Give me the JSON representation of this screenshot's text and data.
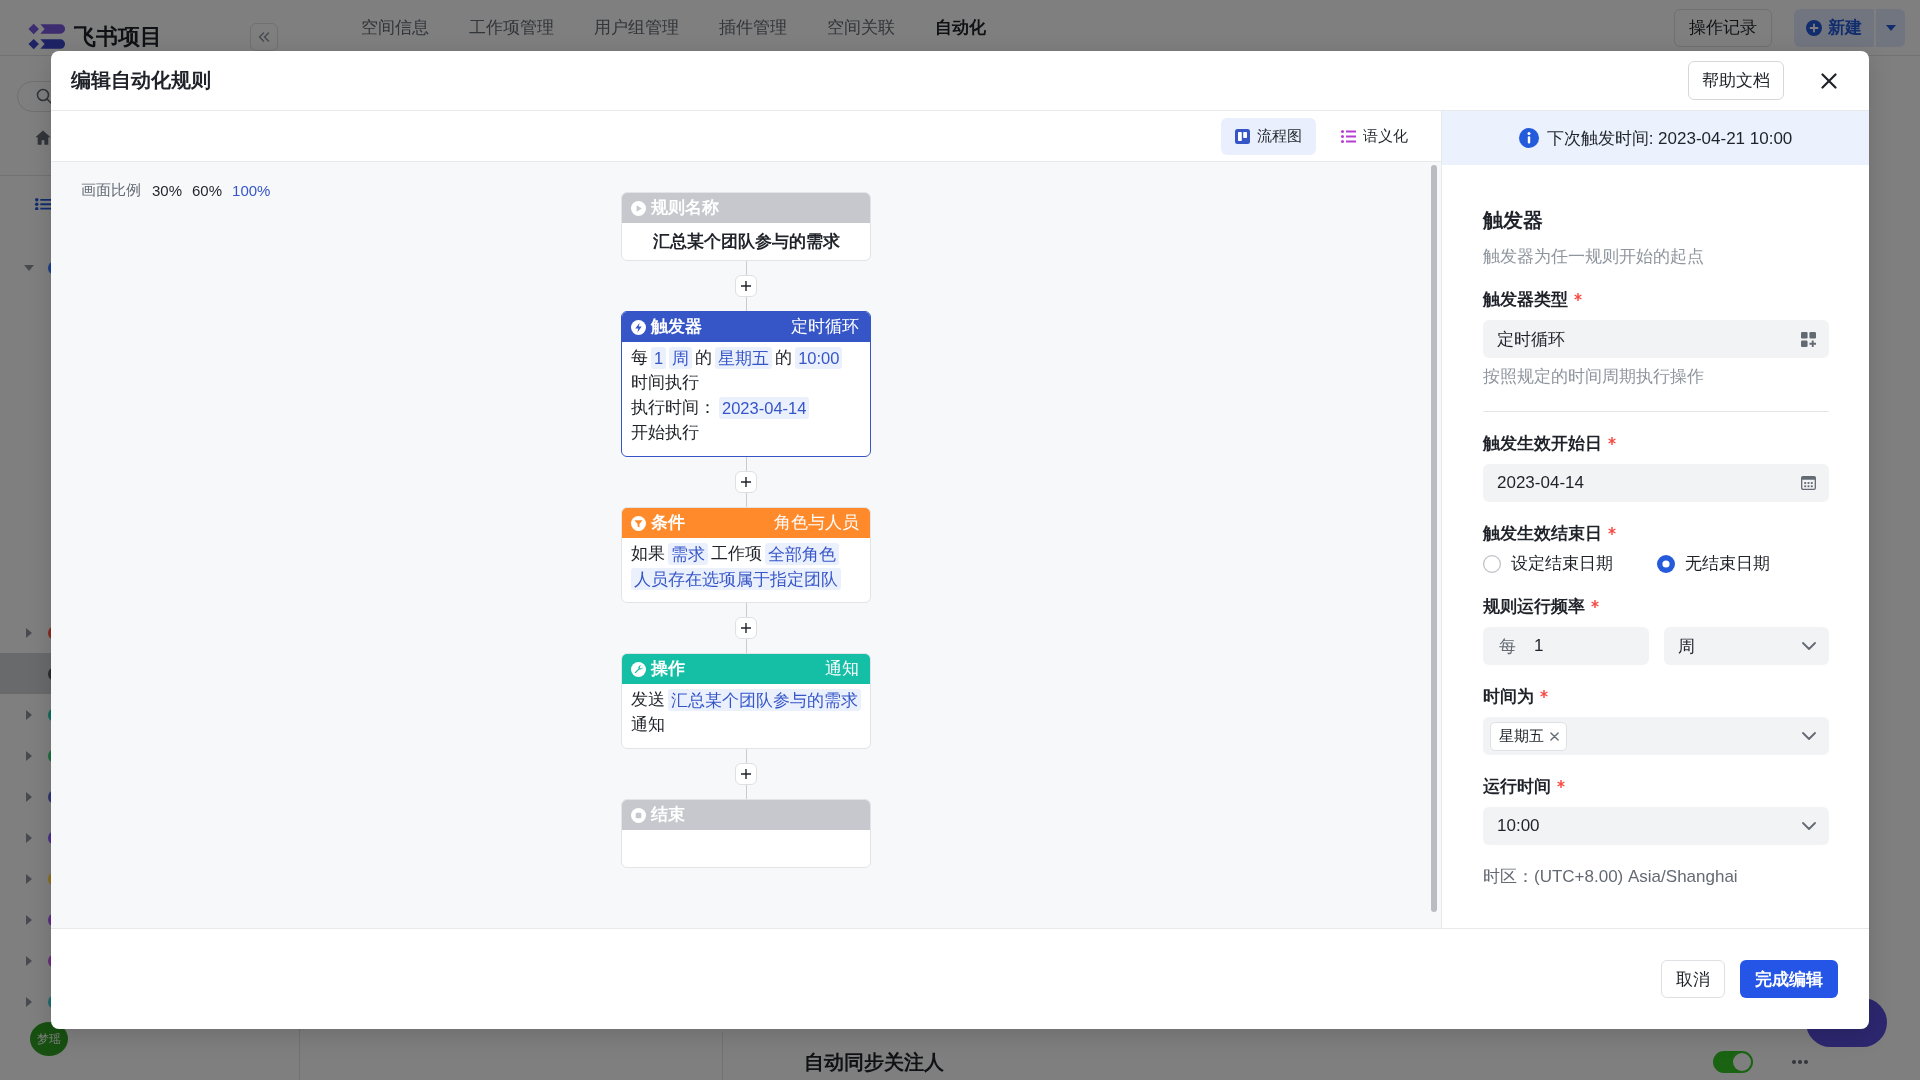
{
  "app": {
    "brand": "飞书项目",
    "nav": [
      {
        "label": "空间信息",
        "selected": false
      },
      {
        "label": "工作项管理",
        "selected": false
      },
      {
        "label": "用户组管理",
        "selected": false
      },
      {
        "label": "插件管理",
        "selected": false
      },
      {
        "label": "空间关联",
        "selected": false
      },
      {
        "label": "自动化",
        "selected": true
      }
    ],
    "history_button": "操作记录",
    "new_button": "新建",
    "sidebar": {
      "tree": [
        {
          "kind": "branch",
          "expanded": true,
          "selected": false,
          "color": "#1d3d8c"
        },
        {
          "kind": "branch",
          "expanded": false,
          "selected": false,
          "color": "#8a2a1e"
        },
        {
          "kind": "leaf",
          "selected": true,
          "color": "#2b2b2b"
        },
        {
          "kind": "branch",
          "expanded": false,
          "selected": false,
          "color": "#0d6b5e"
        },
        {
          "kind": "branch",
          "expanded": false,
          "selected": false,
          "color": "#1d6b3f"
        },
        {
          "kind": "branch",
          "expanded": false,
          "selected": false,
          "color": "#2e3470"
        },
        {
          "kind": "branch",
          "expanded": false,
          "selected": false,
          "color": "#4b2d8a"
        },
        {
          "kind": "branch",
          "expanded": false,
          "selected": false,
          "color": "#8c6d1c"
        },
        {
          "kind": "branch",
          "expanded": false,
          "selected": false,
          "color": "#5a2c80"
        },
        {
          "kind": "branch",
          "expanded": false,
          "selected": false,
          "color": "#6a2d78"
        },
        {
          "kind": "branch",
          "expanded": false,
          "selected": false,
          "color": "#1c6b6e"
        }
      ],
      "avatar": "梦瑶"
    },
    "auto_sync": {
      "label": "自动同步关注人",
      "on": true
    }
  },
  "modal": {
    "title": "编辑自动化规则",
    "help_button": "帮助文档",
    "view_tabs": [
      {
        "kind": "flowchart",
        "label": "流程图",
        "selected": true
      },
      {
        "kind": "semantic",
        "label": "语义化",
        "selected": false
      }
    ],
    "zoom": {
      "label": "画面比例",
      "options": [
        {
          "label": "30%",
          "selected": false
        },
        {
          "label": "60%",
          "selected": false
        },
        {
          "label": "100%",
          "selected": true
        }
      ]
    },
    "flow": {
      "nodes": [
        {
          "kind": "name",
          "color": "#c6c8cd",
          "title": "规则名称",
          "selected": false,
          "body": [
            [
              {
                "kind": "title",
                "text": "汇总某个团队参与的需求"
              }
            ]
          ]
        },
        {
          "kind": "trigger",
          "color": "#3656c8",
          "title": "触发器",
          "tag": "定时循环",
          "selected": true,
          "body": [
            [
              {
                "kind": "text",
                "text": "每"
              },
              {
                "kind": "chip",
                "text": "1"
              },
              {
                "kind": "chip",
                "text": "周"
              },
              {
                "kind": "text",
                "text": "的"
              },
              {
                "kind": "chip",
                "text": "星期五"
              },
              {
                "kind": "text",
                "text": "的"
              },
              {
                "kind": "chip",
                "text": "10:00"
              },
              {
                "kind": "text",
                "text": "时间执行"
              }
            ],
            [
              {
                "kind": "text",
                "text": "执行时间："
              },
              {
                "kind": "chip",
                "text": "2023-04-14"
              },
              {
                "kind": "text",
                "text": "开始执行"
              }
            ]
          ]
        },
        {
          "kind": "condition",
          "color": "#ff8a2b",
          "title": "条件",
          "tag": "角色与人员",
          "selected": false,
          "body": [
            [
              {
                "kind": "text",
                "text": "如果"
              },
              {
                "kind": "chip",
                "text": "需求"
              },
              {
                "kind": "text",
                "text": "工作项"
              },
              {
                "kind": "chip",
                "text": "全部角色"
              },
              {
                "kind": "chip",
                "text": "人员存在选项属于指定团队"
              }
            ]
          ]
        },
        {
          "kind": "action",
          "color": "#14bfa6",
          "title": "操作",
          "tag": "通知",
          "selected": false,
          "body": [
            [
              {
                "kind": "text",
                "text": "发送"
              },
              {
                "kind": "chip",
                "text": "汇总某个团队参与的需求"
              },
              {
                "kind": "text",
                "text": "通知"
              }
            ]
          ]
        },
        {
          "kind": "end",
          "color": "#c6c8cd",
          "title": "结束",
          "selected": false
        }
      ]
    },
    "panel": {
      "next_run": "下次触发时间: 2023-04-21 10:00",
      "title": "触发器",
      "description": "触发器为任一规则开始的起点",
      "fields": [
        {
          "kind": "picker",
          "label": "触发器类型",
          "required": true,
          "value": "定时循环",
          "help": "按照规定的时间周期执行操作"
        },
        {
          "kind": "date",
          "label": "触发生效开始日",
          "required": true,
          "value": "2023-04-14"
        },
        {
          "kind": "radio",
          "label": "触发生效结束日",
          "required": true,
          "options": [
            {
              "label": "设定结束日期",
              "selected": false
            },
            {
              "label": "无结束日期",
              "selected": true
            }
          ]
        },
        {
          "kind": "frequency",
          "label": "规则运行频率",
          "required": true,
          "prefix": "每",
          "value": "1",
          "unit": "周"
        },
        {
          "kind": "tags",
          "label": "时间为",
          "required": true,
          "tags": [
            "星期五"
          ]
        },
        {
          "kind": "select",
          "label": "运行时间",
          "required": true,
          "value": "10:00"
        }
      ],
      "timezone": "时区：(UTC+8.00) Asia/Shanghai"
    },
    "footer": {
      "buttons": [
        {
          "kind": "secondary",
          "label": "取消"
        },
        {
          "kind": "primary",
          "label": "完成编辑"
        }
      ]
    }
  }
}
